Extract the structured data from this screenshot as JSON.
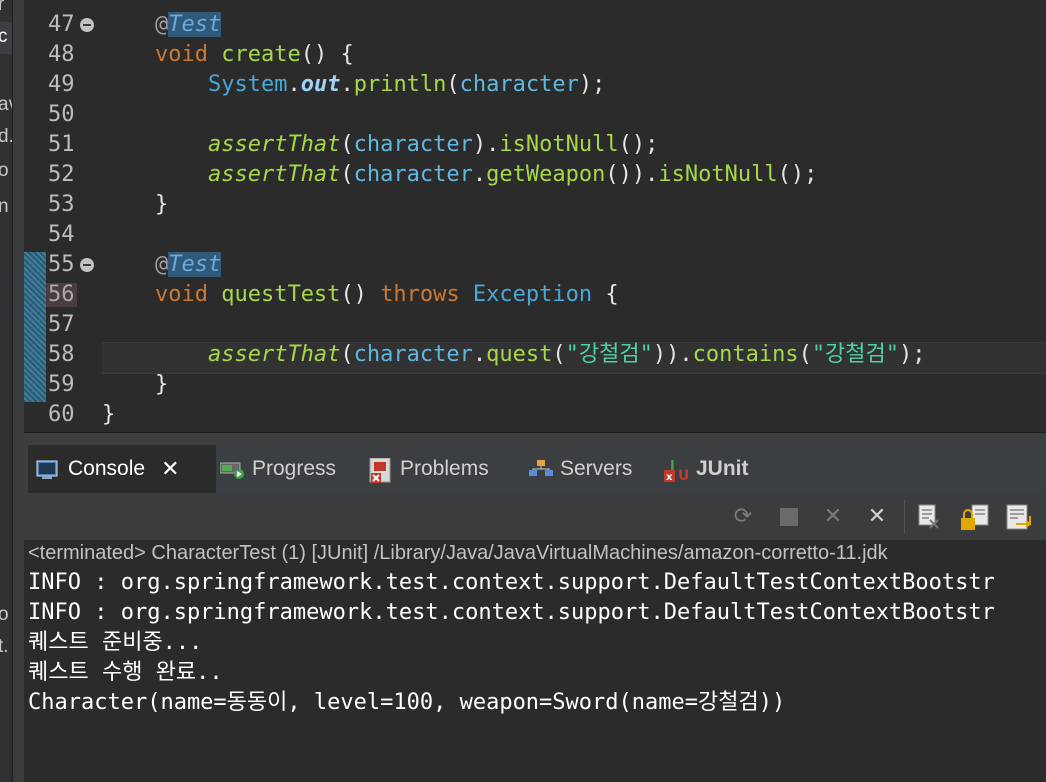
{
  "left_strip_fragments": [
    "r",
    "c",
    "av",
    "d.",
    "o",
    "n",
    "o",
    "t."
  ],
  "editor": {
    "lines": [
      {
        "num": "47",
        "fold": true
      },
      {
        "num": "48"
      },
      {
        "num": "49"
      },
      {
        "num": "50"
      },
      {
        "num": "51"
      },
      {
        "num": "52"
      },
      {
        "num": "53"
      },
      {
        "num": "54"
      },
      {
        "num": "55",
        "fold": true
      },
      {
        "num": "56"
      },
      {
        "num": "57"
      },
      {
        "num": "58"
      },
      {
        "num": "59"
      },
      {
        "num": "60"
      }
    ],
    "code": {
      "at": "@",
      "test": "Test",
      "void": "void",
      "create": "create",
      "parens_open_brace": "() {",
      "system": "System",
      "dot": ".",
      "out": "out",
      "println": "println",
      "lparen": "(",
      "character": "character",
      "rparen_semi": ");",
      "assertThat": "assertThat",
      "rparen": ")",
      "isNotNull": "isNotNull",
      "call_semi": "();",
      "getWeapon": "getWeapon",
      "double_rparen": "())",
      "close_brace": "}",
      "questTest": "questTest",
      "parens": "()",
      "throws": "throws",
      "exception": "Exception",
      "open_brace": "{",
      "quest": "quest",
      "str_sword": "\"강철검\"",
      "rparen2": "))",
      "contains": "contains"
    }
  },
  "view_tabs": {
    "console": "Console",
    "close_symbol": "✕",
    "progress": "Progress",
    "problems": "Problems",
    "servers": "Servers",
    "junit": "JUnit"
  },
  "console": {
    "terminated": "<terminated> CharacterTest (1) [JUnit] /Library/Java/JavaVirtualMachines/amazon-corretto-11.jdk",
    "output": [
      "INFO : org.springframework.test.context.support.DefaultTestContextBootstr",
      "INFO : org.springframework.test.context.support.DefaultTestContextBootstr",
      "퀘스트 준비중...",
      "퀘스트 수행 완료..",
      "Character(name=동동이, level=100, weapon=Sword(name=강철검))"
    ]
  },
  "icons": {
    "toolbar": [
      "refresh-icon",
      "stop-icon",
      "remove-icon",
      "remove-all-icon",
      "clear-console-icon",
      "scroll-lock-icon",
      "word-wrap-icon"
    ]
  },
  "colors": {
    "editor_bg": "#2b2b2b",
    "keyword": "#cc7832",
    "method": "#a6d84a",
    "string": "#4fd1a5",
    "type": "#4aa8d8"
  }
}
